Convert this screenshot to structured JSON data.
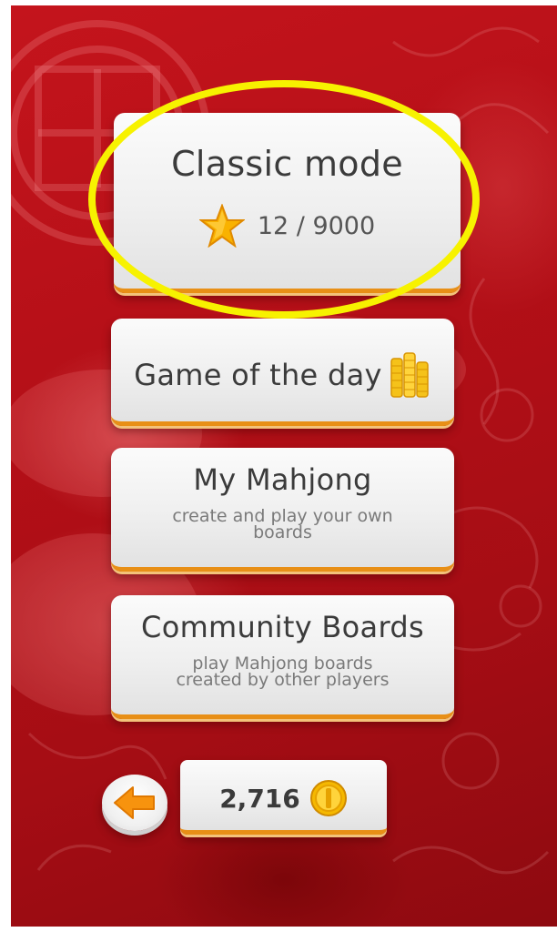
{
  "menu": {
    "classic": {
      "title": "Classic mode",
      "progress": "12 / 9000",
      "icon": "star-icon"
    },
    "game_of_the_day": {
      "title": "Game of the day",
      "icon": "coin-stack-icon"
    },
    "my_mahjong": {
      "title": "My Mahjong",
      "subtitle_line1": "create and play your own",
      "subtitle_line2": "boards"
    },
    "community": {
      "title": "Community Boards",
      "subtitle_line1": "play Mahjong boards",
      "subtitle_line2": "created by other players"
    }
  },
  "footer": {
    "back_icon": "arrow-left-icon",
    "coins": "2,716",
    "coin_icon": "coin-icon"
  },
  "colors": {
    "background": "#b30f17",
    "button_face": "#efefef",
    "button_edge": "#e88f16",
    "highlight": "#f7f200",
    "star": "#f9b200"
  }
}
